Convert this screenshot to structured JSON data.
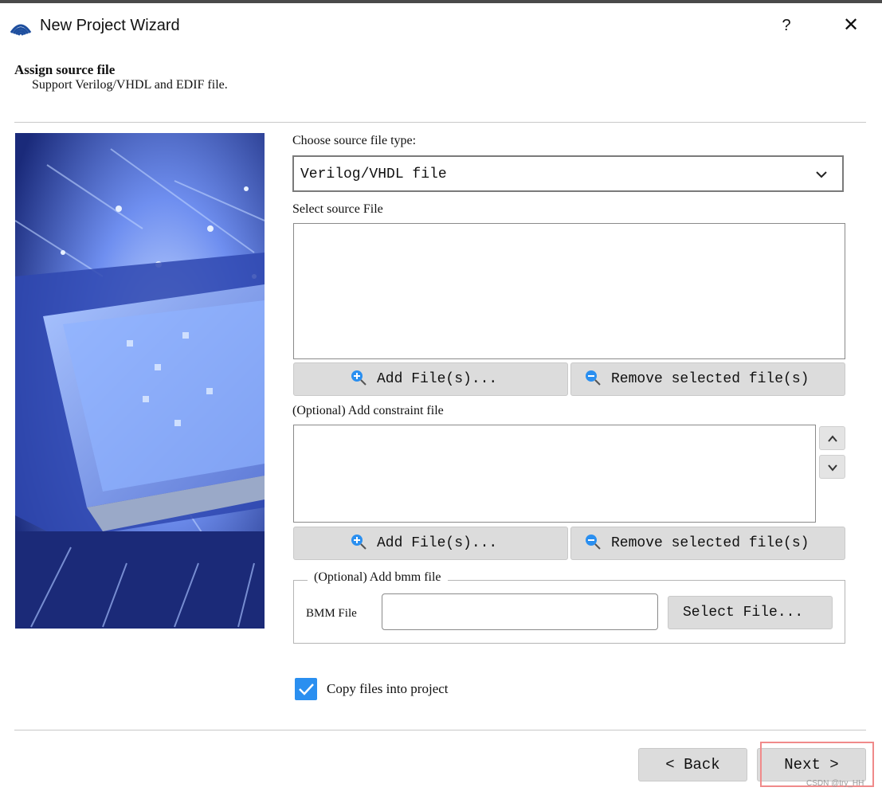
{
  "window": {
    "title": "New Project Wizard",
    "help_label": "?",
    "close_label": "✕"
  },
  "header": {
    "heading": "Assign source file",
    "subheading": "Support Verilog/VHDL and EDIF file."
  },
  "source": {
    "type_label": "Choose source file type:",
    "type_value": "Verilog/VHDL file",
    "select_label": "Select source File",
    "add_label": "Add File(s)...",
    "remove_label": "Remove selected file(s)"
  },
  "constraint": {
    "label": "(Optional) Add constraint file",
    "add_label": "Add File(s)...",
    "remove_label": "Remove selected file(s)"
  },
  "bmm": {
    "group_label": "(Optional) Add bmm file",
    "field_label": "BMM File",
    "value": "",
    "select_label": "Select File..."
  },
  "options": {
    "copy_label": "Copy files into project",
    "copy_checked": true
  },
  "nav": {
    "back_label": "< Back",
    "next_label": "Next >"
  },
  "watermark": "CSDN @try_HH",
  "colors": {
    "accent": "#2a8ff0",
    "button_bg": "#dcdcdc",
    "highlight": "#f08a8a"
  }
}
